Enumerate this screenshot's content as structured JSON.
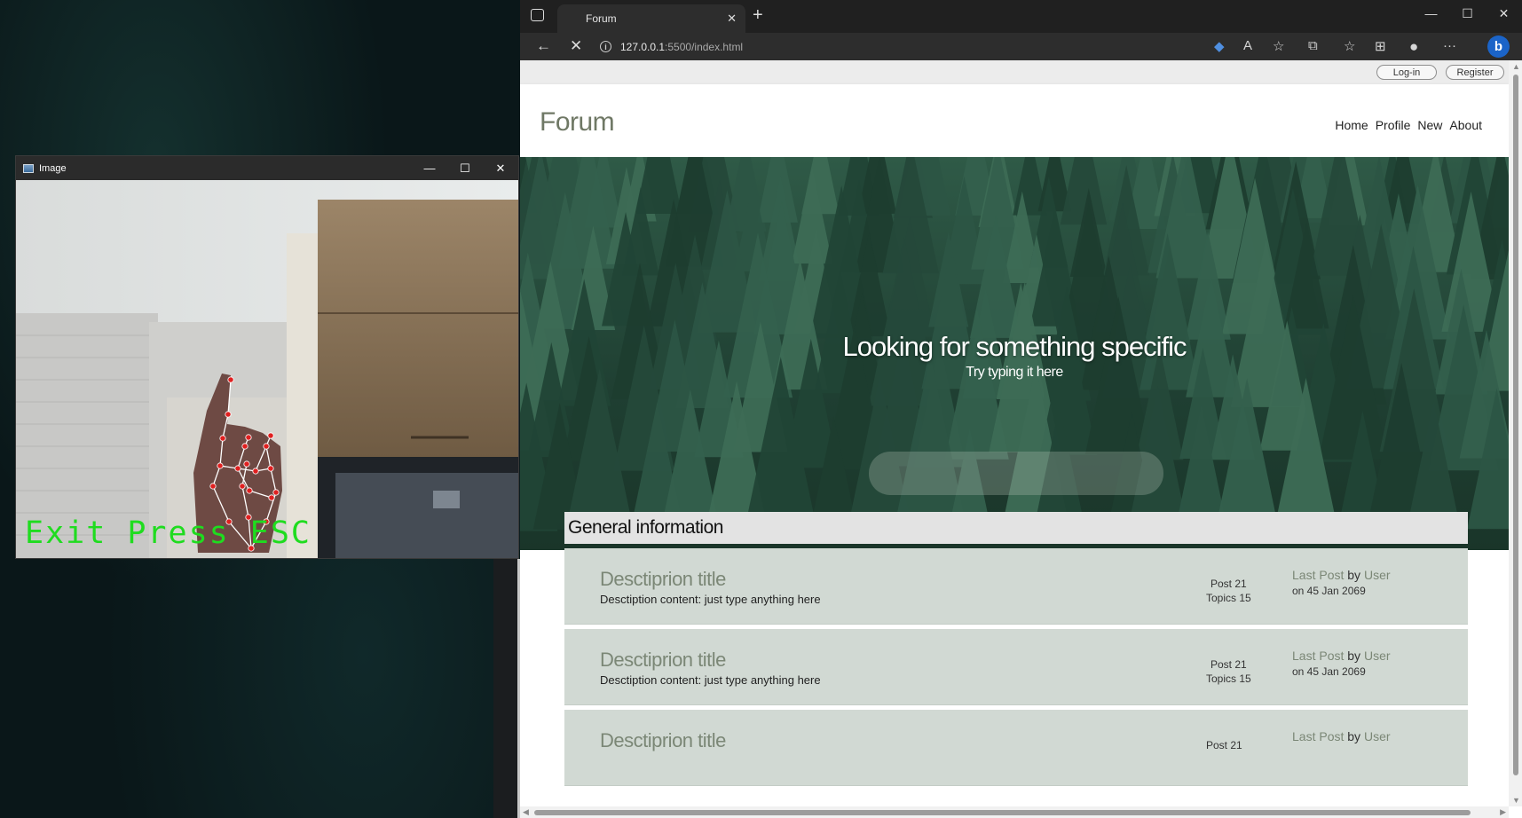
{
  "opencv_window": {
    "title": "Image",
    "overlay_text": "Exit Press ESC",
    "icons": {
      "minimize": "minimize-icon",
      "maximize": "maximize-icon",
      "close": "close-icon"
    }
  },
  "browser": {
    "tab_title": "Forum",
    "url_host": "127.0.0.1",
    "url_path": ":5500/index.html",
    "icons": [
      "tab-actions-icon",
      "back-icon",
      "stop-icon",
      "site-info-icon",
      "extension-icon",
      "read-aloud-icon",
      "add-favorite-icon",
      "extensions-icon",
      "favorites-icon",
      "collections-icon",
      "profile-icon",
      "more-icon",
      "bing-icon"
    ]
  },
  "auth": {
    "login_label": "Log-in",
    "register_label": "Register"
  },
  "site": {
    "logo": "Forum",
    "nav": [
      "Home",
      "Profile",
      "New",
      "About"
    ]
  },
  "hero": {
    "title": "Looking for something specific",
    "subtitle": "Try typing it here",
    "search_placeholder": ""
  },
  "general_info": {
    "heading": "General information",
    "topics": [
      {
        "title": "Desctiprion title",
        "description": "Desctiption content: just type anything here",
        "posts": "Post 21",
        "topics": "Topics 15",
        "last_post": "Last Post",
        "by": "by",
        "user": "User",
        "date": "on 45 Jan 2069"
      },
      {
        "title": "Desctiprion title",
        "description": "Desctiption content: just type anything here",
        "posts": "Post 21",
        "topics": "Topics 15",
        "last_post": "Last Post",
        "by": "by",
        "user": "User",
        "date": "on 45 Jan 2069"
      },
      {
        "title": "Desctiprion title",
        "description": "",
        "posts": "Post 21",
        "topics": "",
        "last_post": "Last Post",
        "by": "by",
        "user": "User",
        "date": ""
      }
    ]
  },
  "colors": {
    "accent_olive": "#7b8776",
    "topic_bg": "#d1d9d3",
    "overlay_green": "#1fdc1f",
    "landmark_red": "#e02020"
  }
}
